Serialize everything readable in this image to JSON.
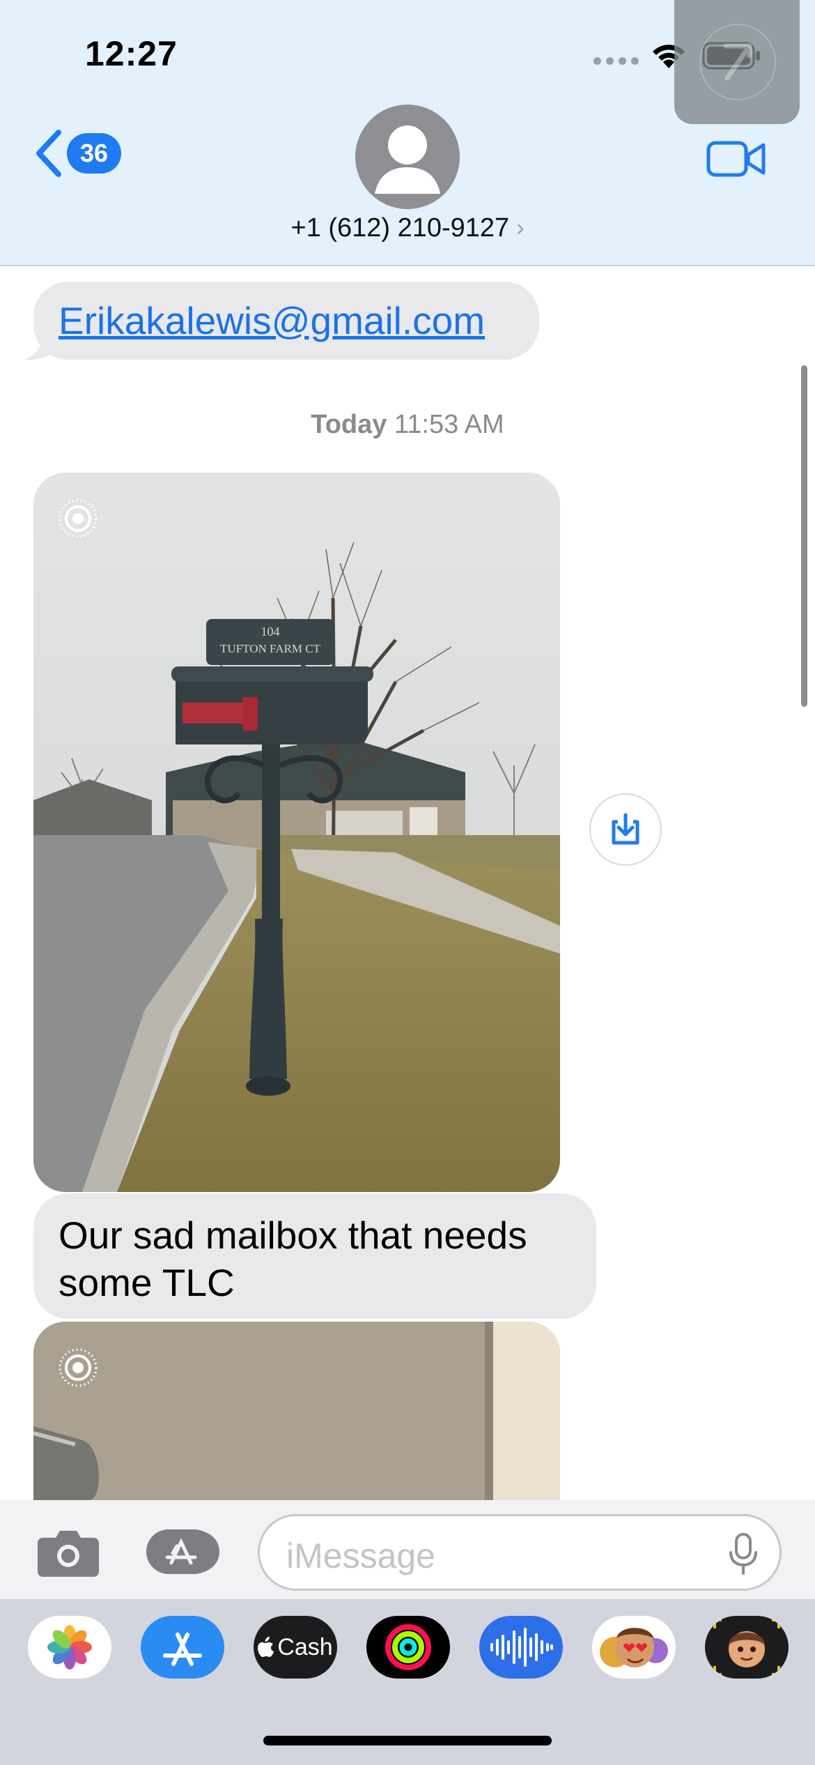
{
  "status_bar": {
    "time": "12:27"
  },
  "header": {
    "unread_count": "36",
    "contact_name": "+1 (612) 210-9127",
    "contact_chevron": "›"
  },
  "messages": {
    "email_link": "Erikakalewis@gmail.com",
    "timestamp_day": "Today",
    "timestamp_time": "11:53 AM",
    "caption": "Our sad mailbox that needs some TLC",
    "mailbox_sign_line1": "104",
    "mailbox_sign_line2": "TUFTON FARM CT"
  },
  "composer": {
    "placeholder": "iMessage"
  },
  "app_drawer": {
    "apps": [
      "photos-icon",
      "app-store-icon",
      "apple-cash-icon",
      "activity-icon",
      "audio-message-icon",
      "memoji-stickers-icon",
      "memoji-icon"
    ],
    "cash_label": "Cash"
  },
  "colors": {
    "accent": "#1f7bf1",
    "header_bg": "#e2f1fb",
    "bubble_bg": "#e9e9eb"
  }
}
